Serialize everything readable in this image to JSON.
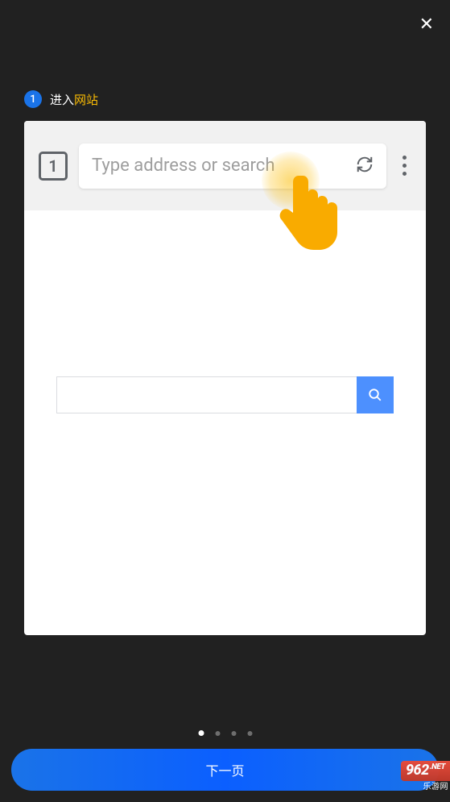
{
  "close": "✕",
  "step": {
    "number": "1",
    "text_prefix": "进入",
    "text_highlight": "网站"
  },
  "browser": {
    "tab_count": "1",
    "address_placeholder": "Type address or search"
  },
  "pagination": {
    "total": 4,
    "active": 0
  },
  "next_button": "下一页",
  "watermark": {
    "main": "962",
    "suffix": ".NET",
    "sub": "乐游网"
  }
}
